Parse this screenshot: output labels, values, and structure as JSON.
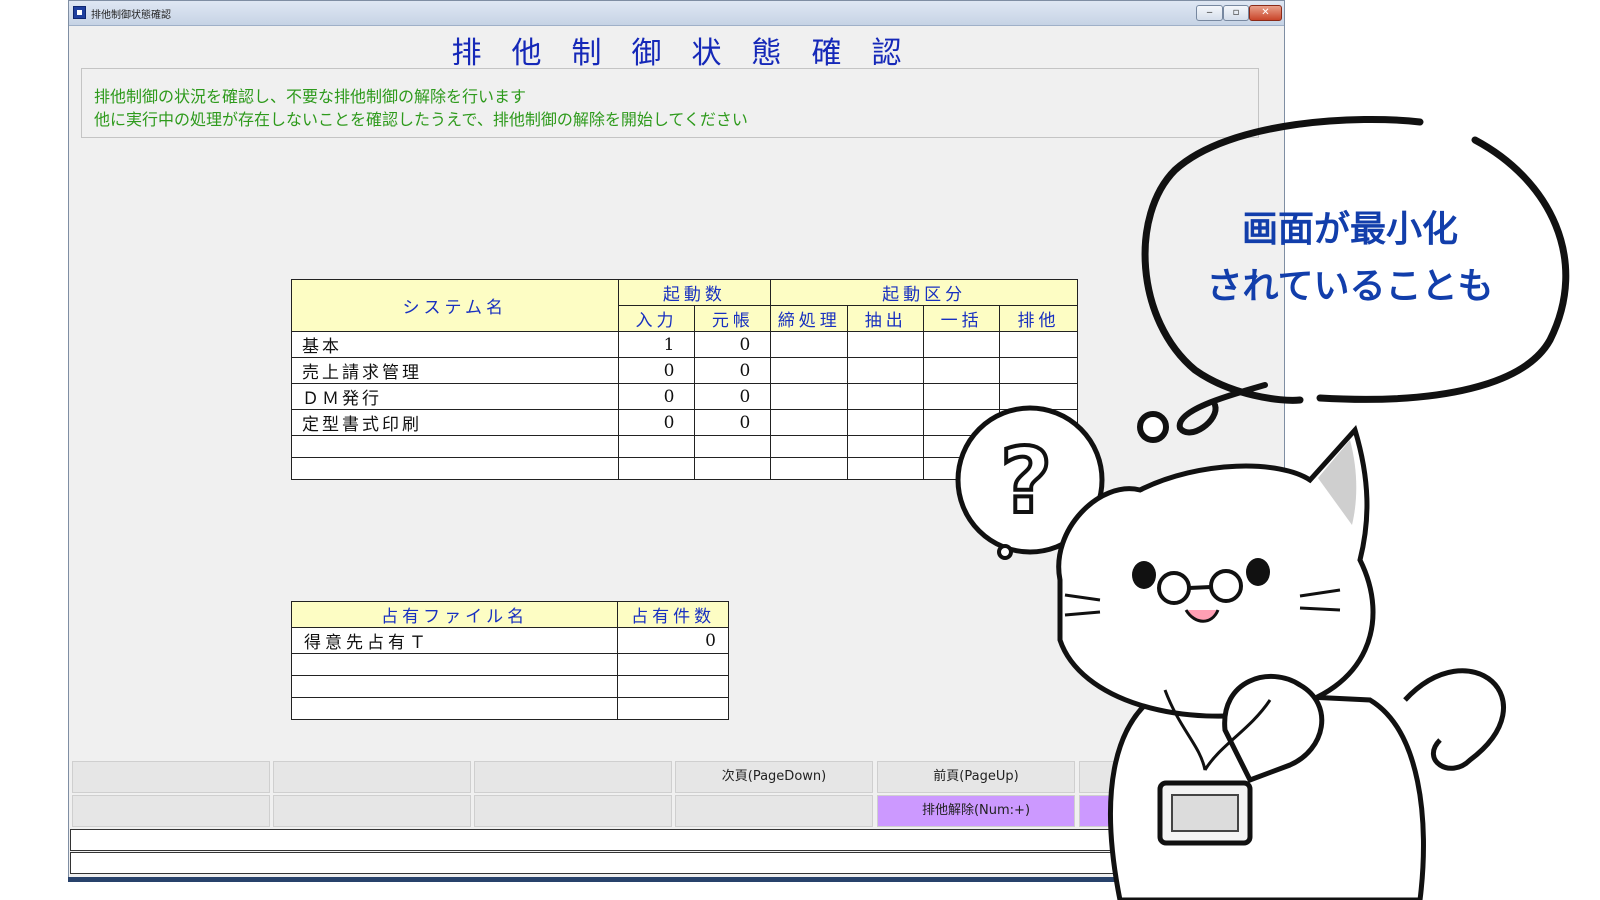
{
  "window": {
    "title": "排他制御状態確認",
    "controls": {
      "minimize": "‒",
      "maximize": "▫",
      "close": "✕"
    }
  },
  "page": {
    "heading": "排他制御状態確認",
    "message_line1": "排他制御の状況を確認し、不要な排他制御の解除を行います",
    "message_line2": "他に実行中の処理が存在しないことを確認したうえで、排他制御の解除を開始してください"
  },
  "system_table": {
    "headers": {
      "system_name": "システム名",
      "launch_count": "起動数",
      "input": "入力",
      "ledger": "元帳",
      "launch_type": "起動区分",
      "closing": "締処理",
      "extract": "抽出",
      "batch": "一括",
      "exclusive": "排他"
    },
    "rows": [
      {
        "name": "基本",
        "input": "1",
        "ledger": "0"
      },
      {
        "name": "売上請求管理",
        "input": "0",
        "ledger": "0"
      },
      {
        "name": "ＤＭ発行",
        "input": "0",
        "ledger": "0"
      },
      {
        "name": "定型書式印刷",
        "input": "0",
        "ledger": "0"
      },
      {
        "name": "",
        "input": "",
        "ledger": ""
      },
      {
        "name": "",
        "input": "",
        "ledger": ""
      }
    ]
  },
  "occupied_table": {
    "headers": {
      "file_name": "占有ファイル名",
      "count": "占有件数"
    },
    "rows": [
      {
        "name": "得意先占有Ｔ",
        "count": "0"
      },
      {
        "name": "",
        "count": ""
      },
      {
        "name": "",
        "count": ""
      },
      {
        "name": "",
        "count": ""
      }
    ]
  },
  "function_keys": {
    "row1": [
      "",
      "",
      "",
      "次頁(PageDown)",
      "前頁(PageUp)",
      ""
    ],
    "row2": [
      "",
      "",
      "",
      "",
      "排他解除(Num:+)",
      ""
    ]
  },
  "overlay": {
    "bubble_line1": "画面が最小化",
    "bubble_line2": "されていることも",
    "question_mark": "?"
  },
  "colors": {
    "heading": "#1528b8",
    "message": "#2e9a1c",
    "header_bg": "#fdfdc4",
    "purple_key": "#cc99ff",
    "bubble_text": "#123eab"
  }
}
